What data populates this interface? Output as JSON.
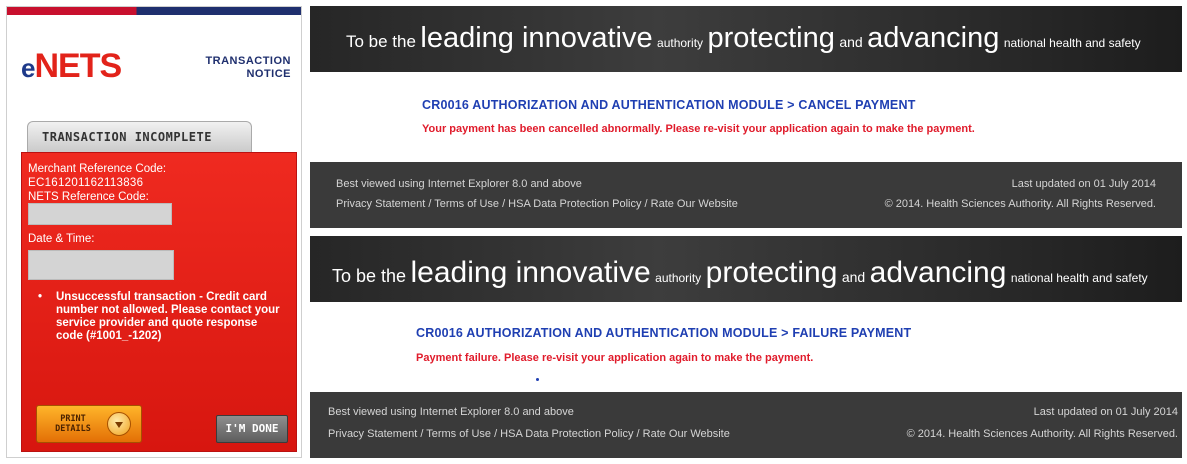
{
  "enets": {
    "logo_e": "e",
    "logo_nets": "NETS",
    "notice_line1": "TRANSACTION",
    "notice_line2": "NOTICE",
    "tab_label": "TRANSACTION INCOMPLETE",
    "merchant_label": "Merchant Reference Code:",
    "merchant_value": "EC161201162113836",
    "nets_label": "NETS Reference Code:",
    "datetime_label": "Date & Time:",
    "bullet_text": "Unsuccessful transaction - Credit card number not allowed. Please contact your service provider and quote response code (#1001_-1202)",
    "print_label": "PRINT DETAILS",
    "done_label": "I'M DONE",
    "colors": {
      "brand_red": "#e2231a",
      "brand_blue": "#1e3a8a",
      "panel_red": "#ef2a20",
      "print_orange": "#ffb52a"
    },
    "icons": {
      "print": "play-arrow-icon"
    }
  },
  "hsa_banner": {
    "part1": "To be the",
    "part2": "leading innovative",
    "part3": "authority",
    "part4": "protecting",
    "part5": "and",
    "part6": "advancing",
    "part7": "national health and safety"
  },
  "panel1": {
    "title": "CR0016 AUTHORIZATION AND AUTHENTICATION MODULE > CANCEL PAYMENT",
    "message": "Your payment has been cancelled abnormally. Please re-visit your application again to make the payment."
  },
  "panel2": {
    "title": "CR0016 AUTHORIZATION AND AUTHENTICATION MODULE > FAILURE PAYMENT",
    "message": "Payment failure. Please re-visit your application again to make the payment."
  },
  "footer": {
    "browser_note": "Best viewed using Internet Explorer 8.0 and above",
    "links": "Privacy Statement / Terms of Use / HSA Data Protection Policy / Rate Our Website",
    "updated": "Last updated on 01 July 2014",
    "copyright": "© 2014. Health Sciences Authority. All Rights Reserved."
  }
}
